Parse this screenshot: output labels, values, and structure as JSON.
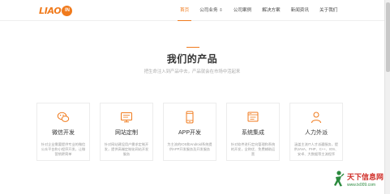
{
  "header": {
    "logo_text": "LIAO",
    "logo_badge": "IN",
    "nav": [
      {
        "label": "首页",
        "active": true
      },
      {
        "label": "公司业务 ⇩",
        "active": false
      },
      {
        "label": "公司案例",
        "active": false
      },
      {
        "label": "解决方案",
        "active": false
      },
      {
        "label": "新闻资讯",
        "active": false
      },
      {
        "label": "关于我们",
        "active": false
      }
    ]
  },
  "products": {
    "title": "我们的产品",
    "subtitle": "把生命注入到产品中去，产品就会在市场中活起来",
    "cards": [
      {
        "icon": "wechat-icon",
        "title": "微信开发",
        "desc": "针对企业需要提供专业的微信公众平台和小程序开发，让微营销更简单"
      },
      {
        "icon": "web-monitor-icon",
        "title": "网站定制",
        "desc": "针对网站建设用户需求定制开发，提供高端定制化网站开发服务"
      },
      {
        "icon": "mobile-app-icon",
        "title": "APP开发",
        "desc": "为主流的IOS和Android系统提供APP开发服务及开发服务"
      },
      {
        "icon": "system-integration-icon",
        "title": "系统集成",
        "desc": "针对软件进行定向管理和系统的开发，全称优、免费辅助运营"
      },
      {
        "icon": "outsourcing-person-icon",
        "title": "人力外派",
        "desc": "涵盖主流IT人才派遣服务，提供JAVA、PHP、C++、IOS、安卓、大数据等主流程序"
      }
    ]
  },
  "watermark": {
    "name": "天下信息网",
    "url": "www.tx009.com"
  },
  "colors": {
    "accent": "#f07a1c",
    "watermark_red": "#d0302a",
    "watermark_green": "#2b8a3e"
  }
}
